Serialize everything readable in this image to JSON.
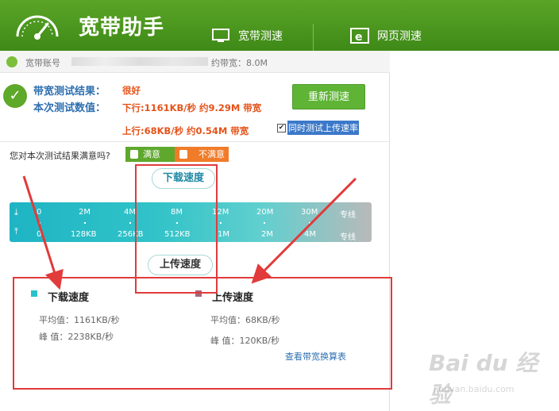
{
  "app": {
    "title": "宽带助手"
  },
  "tabs": [
    {
      "label": "宽带测速"
    },
    {
      "label": "网页测速"
    }
  ],
  "account": {
    "label": "宽带账号",
    "bandwidth": "约带宽：8.0M"
  },
  "result": {
    "label": "带宽测试结果：",
    "value": "很好",
    "data_label": "本次测试数值：",
    "download": "下行:1161KB/秒 约9.29M 带宽",
    "upload": "上行:68KB/秒 约0.54M 带宽"
  },
  "retest_label": "重新测速",
  "checkbox": {
    "label": "同时测试上传速率",
    "checked": "✔"
  },
  "feedback": {
    "question": "您对本次测试结果满意吗?",
    "satisfied": "满意",
    "unsatisfied": "不满意"
  },
  "bubbles": {
    "download": "下载速度",
    "upload": "上传速度"
  },
  "scale": {
    "download_ticks": [
      "0",
      "2M",
      "4M",
      "8M",
      "12M",
      "20M",
      "30M",
      "专线"
    ],
    "upload_ticks": [
      "0",
      "128KB",
      "256KB",
      "512KB",
      "1M",
      "2M",
      "4M",
      "专线"
    ]
  },
  "download_stats": {
    "title": "下载速度",
    "avg": "平均值：1161KB/秒",
    "peak": "峰  值：2238KB/秒"
  },
  "upload_stats": {
    "title": "上传速度",
    "avg": "平均值：68KB/秒",
    "peak": "峰  值：120KB/秒"
  },
  "link_label": "查看带宽换算表",
  "watermark": {
    "brand": "Bai du 经验",
    "url": "jingyan.baidu.com"
  },
  "colors": {
    "header": "#4a9a1e",
    "accent_green": "#5fb436",
    "accent_orange": "#f07c2a",
    "annotation_red": "#e13b3b",
    "teal": "#28c1c9"
  }
}
